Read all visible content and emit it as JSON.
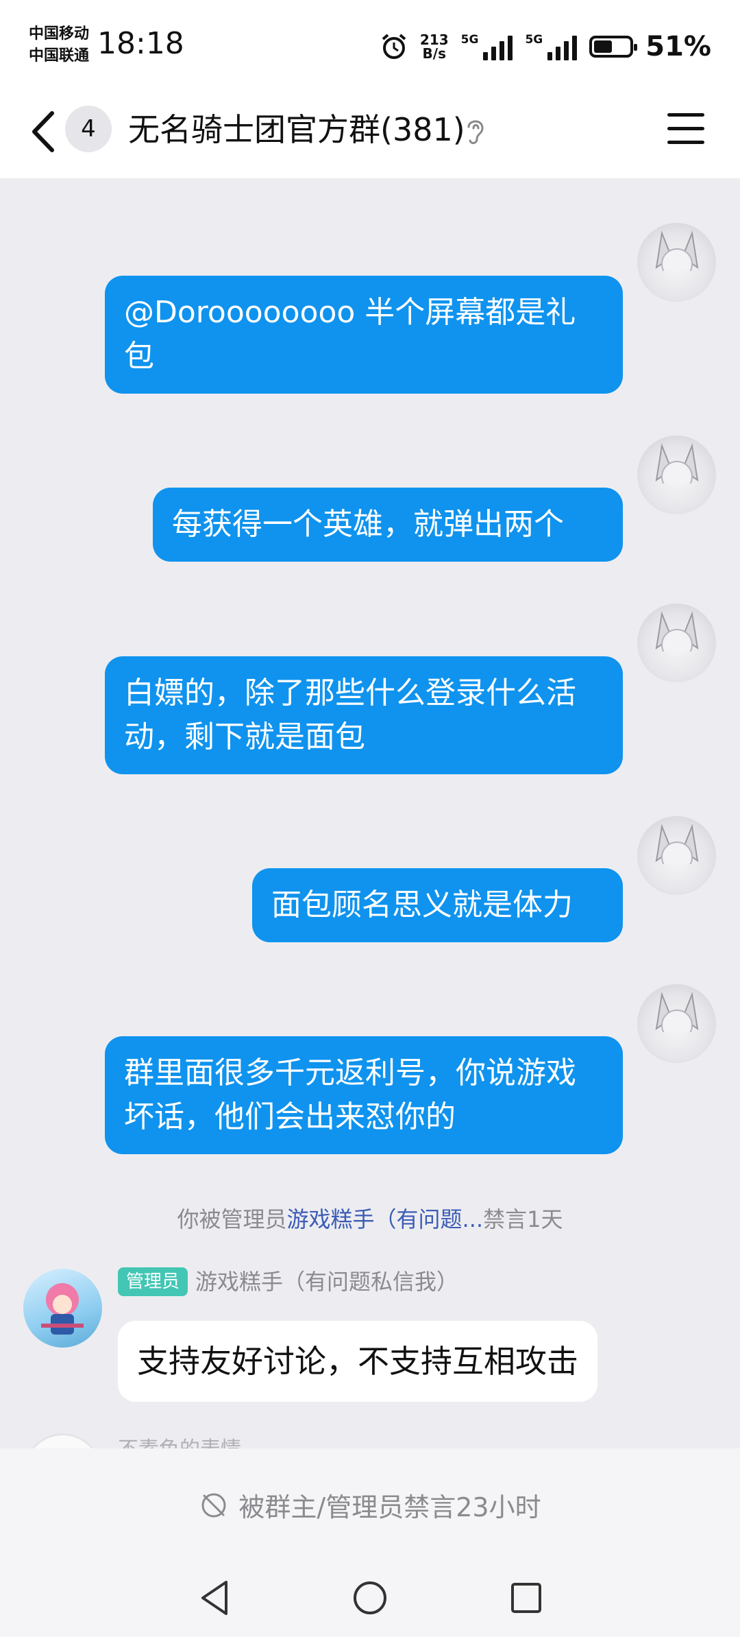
{
  "status_bar": {
    "carrier_1": "中国移动",
    "carrier_2": "中国联通",
    "time": "18:18",
    "net_speed_value": "213",
    "net_speed_unit": "B/s",
    "sim1_type": "5G",
    "sim2_type": "5G",
    "battery_percent": "51%"
  },
  "header": {
    "unread_count": "4",
    "group_title": "无名骑士团官方群(381)"
  },
  "messages_out": [
    {
      "text": "@Doroooooooo 半个屏幕都是礼包"
    },
    {
      "text": "每获得一个英雄，就弹出两个"
    },
    {
      "text": "白嫖的，除了那些什么登录什么活动，剩下就是面包"
    },
    {
      "text": "面包顾名思义就是体力"
    },
    {
      "text": "群里面很多千元返利号，你说游戏坏话，他们会出来怼你的"
    }
  ],
  "system_note": {
    "prefix": "你被管理员",
    "admin_name": "游戏糕手（有问题...",
    "suffix": "禁言1天"
  },
  "message_in": {
    "role_tag": "管理员",
    "sender": "游戏糕手（有问题私信我）",
    "text": "支持友好讨论，不支持互相攻击"
  },
  "next_sender_partial": "不素色的表情",
  "mute_bar": {
    "text": "被群主/管理员禁言23小时"
  },
  "colors": {
    "bubble_out": "#0f93ee",
    "admin_tag": "#43c6b4",
    "background": "#ededf1"
  }
}
